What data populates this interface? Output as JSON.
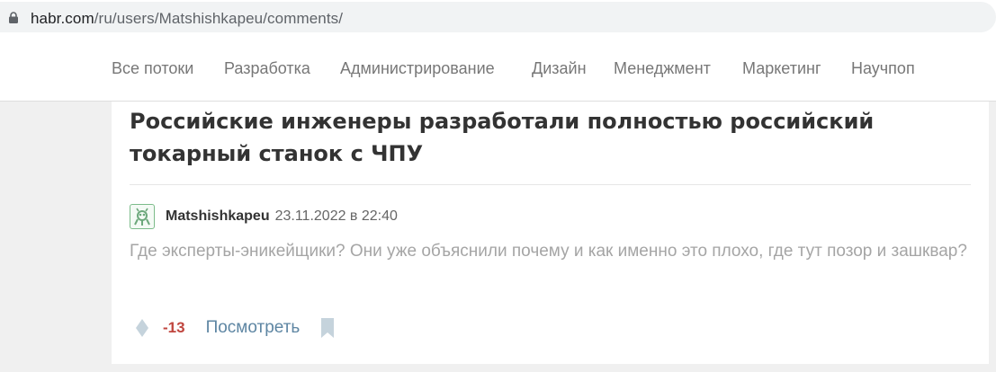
{
  "browser": {
    "url_host": "habr.com",
    "url_path": "/ru/users/Matshishkapeu/comments/"
  },
  "nav": {
    "items": [
      {
        "label": "Все потоки"
      },
      {
        "label": "Разработка"
      },
      {
        "label": "Администрирование"
      },
      {
        "label": "Дизайн"
      },
      {
        "label": "Менеджмент"
      },
      {
        "label": "Маркетинг"
      },
      {
        "label": "Научпоп"
      }
    ]
  },
  "post": {
    "title": "Российские инженеры разработали полностью российский токарный станок с ЧПУ"
  },
  "comment": {
    "author": "Matshishkapeu",
    "date": "23.11.2022 в 22:40",
    "text": "Где эксперты-эникейщики? Они уже объяснили почему и как именно это плохо, где тут позор и зашквар?",
    "score": "-13",
    "view_label": "Посмотреть"
  },
  "colors": {
    "score_negative": "#c0463f",
    "link": "#5e86a3",
    "avatar_accent": "#7cbc8a"
  },
  "icons": {
    "lock": "lock-icon",
    "avatar": "avatar-icon",
    "vote": "vote-icon",
    "bookmark": "bookmark-icon"
  }
}
